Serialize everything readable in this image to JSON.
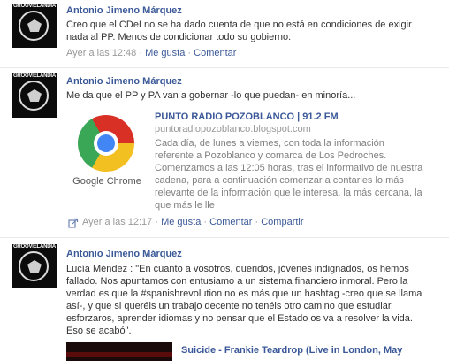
{
  "posts": [
    {
      "author": "Antonio Jimeno Márquez",
      "avatar_text": "GROOVIELANDIA",
      "lines": [
        "Creo que el CDeI no se ha dado cuenta de que no está en condiciones de exigir",
        "nada al PP. Menos de condicionar todo su gobierno."
      ],
      "time": "Ayer a las 12:48",
      "like": "Me gusta",
      "comment": "Comentar"
    },
    {
      "author": "Antonio Jimeno Márquez",
      "avatar_text": "GROOVIELANDIA",
      "lines": [
        "Me da que el PP y PA van a gobernar -lo que puedan- en minoría..."
      ],
      "share": {
        "title": "PUNTO RADIO POZOBLANCO | 91.2 FM",
        "url": "puntoradiopozoblanco.blogspot.com",
        "thumb_caption": "Google Chrome",
        "desc_lines": [
          "Cada día, de lunes a viernes, con toda la información",
          "referente a Pozoblanco y comarca de Los Pedroches.",
          "Comenzamos a las 12:05 horas, tras el informativo de nuestra",
          "cadena, para a continuación comenzar a contarles lo más",
          "relevante de la información que le interesa, la más cercana, la",
          "que más le lle"
        ]
      },
      "time": "Ayer a las 12:17",
      "like": "Me gusta",
      "comment": "Comentar",
      "share_action": "Compartir"
    },
    {
      "author": "Antonio Jimeno Márquez",
      "avatar_text": "GROOVIELANDIA",
      "lines": [
        "Lucía Méndez : \"En cuanto a vosotros, queridos, jóvenes indignados, os hemos",
        "fallado. Nos apuntamos con entusiamo a un sistema financiero inmoral. Pero la",
        "verdad es que la #spanishrevolution no es más que un hashtag -creo que se llama",
        "así-, y que si queréis un trabajo decente no tenéis otro camino que estudiar,",
        "esforzaros, aprender idiomas y no pensar que el Estado os va a resolver la vida.",
        "Eso se acabó\"."
      ],
      "video_title": "Suicide - Frankie Teardrop (Live in London, May"
    }
  ],
  "separator": "·",
  "colors": {
    "link": "#3b5998",
    "meta": "#999999",
    "text": "#333333"
  }
}
